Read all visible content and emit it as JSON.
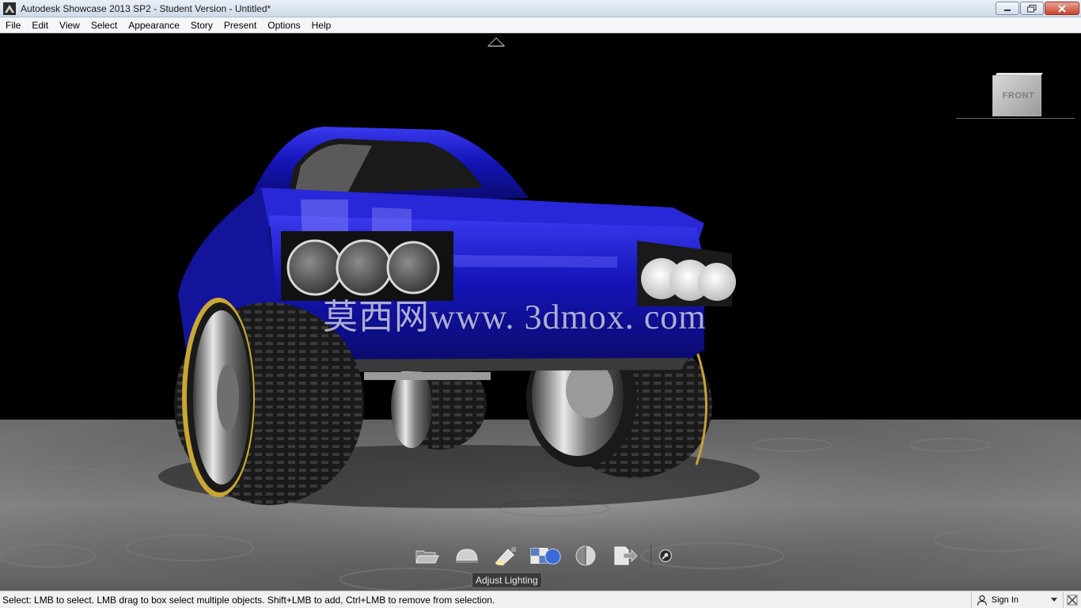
{
  "window": {
    "title": "Autodesk Showcase 2013 SP2 - Student Version - Untitled*",
    "controls": [
      "minimize",
      "restore",
      "close"
    ]
  },
  "menu": {
    "items": [
      "File",
      "Edit",
      "View",
      "Select",
      "Appearance",
      "Story",
      "Present",
      "Options",
      "Help"
    ]
  },
  "viewport": {
    "watermark": "莫西网www. 3dmox. com",
    "viewcube_label": "FRONT",
    "colors": {
      "car_body": "#1c1cc8",
      "floor": "#8e8e8e",
      "background": "#000000",
      "tire_stripe": "#d8b43a"
    }
  },
  "toolbar": {
    "tools": [
      "open-folder-icon",
      "environment-dome-icon",
      "adjust-lighting-icon",
      "materials-icon",
      "shadows-icon",
      "export-icon",
      "settings-icon"
    ],
    "tooltip": "Adjust Lighting"
  },
  "status": {
    "text": "Select: LMB to select. LMB drag to box select multiple objects. Shift+LMB to add, Ctrl+LMB to remove from selection.",
    "signin_label": "Sign In"
  }
}
